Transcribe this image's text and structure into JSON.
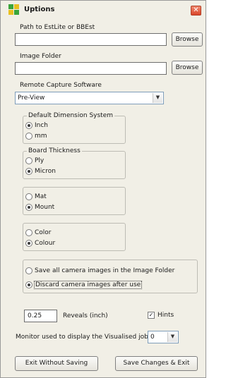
{
  "window": {
    "title": "Uptions",
    "close_glyph": "✕"
  },
  "path": {
    "label": "Path to EstLite or BBEst",
    "value": "",
    "browse_label": "Browse"
  },
  "image_folder": {
    "label": "Image Folder",
    "value": "",
    "browse_label": "Browse"
  },
  "capture_software": {
    "label": "Remote Capture Software",
    "selected": "Pre-View"
  },
  "dimension_system": {
    "caption": "Default Dimension System",
    "options": [
      {
        "label": "Inch",
        "checked": true
      },
      {
        "label": "mm",
        "checked": false
      }
    ]
  },
  "board_thickness": {
    "caption": "Board Thickness",
    "options": [
      {
        "label": "Ply",
        "checked": false
      },
      {
        "label": "Micron",
        "checked": true
      }
    ]
  },
  "mat_mount": {
    "options": [
      {
        "label": "Mat",
        "checked": false
      },
      {
        "label": "Mount",
        "checked": true
      }
    ]
  },
  "color_spelling": {
    "options": [
      {
        "label": "Color",
        "checked": false
      },
      {
        "label": "Colour",
        "checked": true
      }
    ]
  },
  "camera_images": {
    "options": [
      {
        "label": "Save all camera images in the Image Folder",
        "checked": false
      },
      {
        "label": "Discard camera images after use",
        "checked": true
      }
    ]
  },
  "reveals": {
    "value": "0.25",
    "label": "Reveals (inch)"
  },
  "hints": {
    "label": "Hints",
    "checked": true,
    "check_glyph": "✓"
  },
  "monitor": {
    "label": "Monitor used to display the Visualised job",
    "selected": "0"
  },
  "footer": {
    "exit_label": "Exit Without Saving",
    "save_label": "Save Changes & Exit"
  },
  "colors": {
    "window_bg": "#f1efe6",
    "close_red": "#d9452a"
  }
}
